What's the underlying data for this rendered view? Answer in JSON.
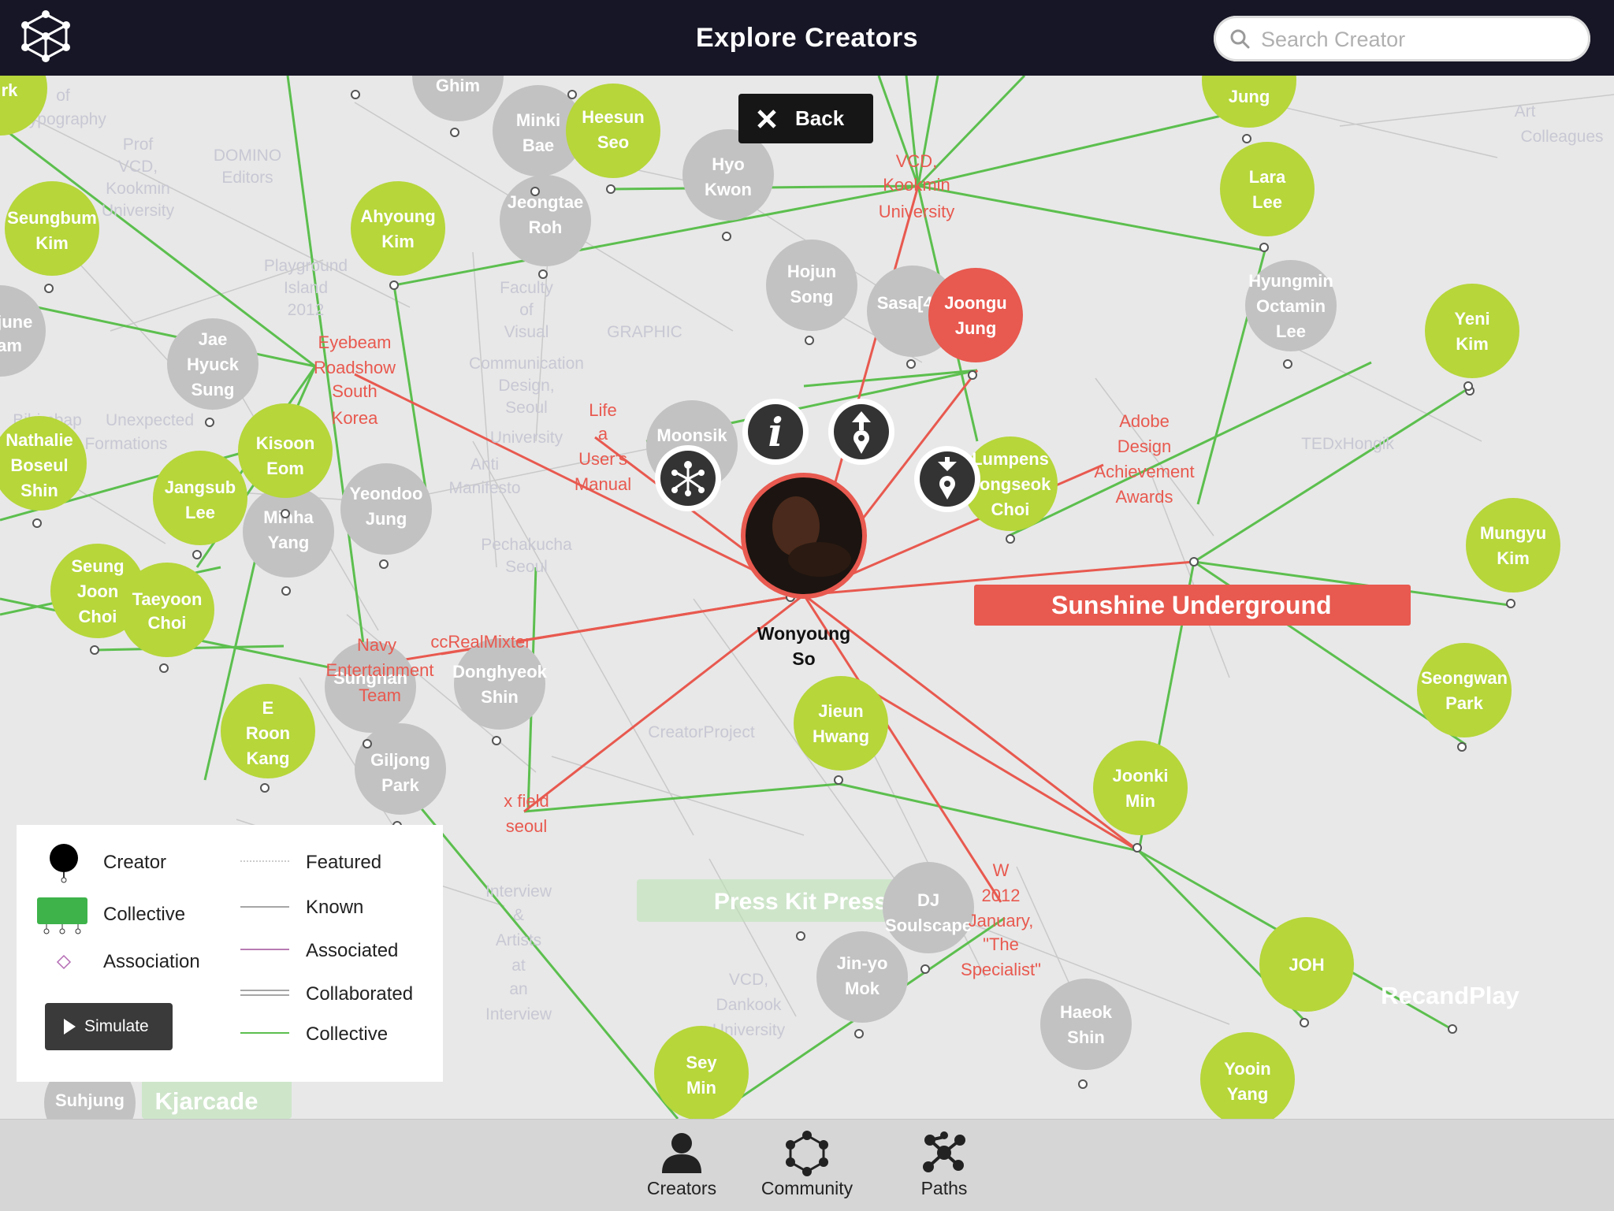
{
  "header": {
    "title": "Explore Creators",
    "search_placeholder": "Search Creator"
  },
  "back_button": {
    "label": "Back"
  },
  "selected_creator": {
    "name_line1": "Wonyoung",
    "name_line2": "So"
  },
  "highlight_banner": "Sunshine Underground",
  "colors": {
    "topbar": "#171626",
    "creator_green": "#b6d63a",
    "creator_grey": "#bdbdbd",
    "selected_red": "#e8594f",
    "collective_line": "#5cbf4e",
    "association_line": "#e8594f"
  },
  "creators_green": [
    {
      "lines": [
        "Heesun",
        "Seo"
      ]
    },
    {
      "lines": [
        "Ahyoung",
        "Kim"
      ]
    },
    {
      "lines": [
        "Seungbum",
        "Kim"
      ]
    },
    {
      "lines": [
        "Kisoon",
        "Eom"
      ]
    },
    {
      "lines": [
        "Jangsub",
        "Lee"
      ]
    },
    {
      "lines": [
        "Nathalie",
        "Boseul",
        "Shin"
      ]
    },
    {
      "lines": [
        "Seung",
        "Joon",
        "Choi"
      ]
    },
    {
      "lines": [
        "Taeyoon",
        "Choi"
      ]
    },
    {
      "lines": [
        "E",
        "Roon",
        "Kang"
      ]
    },
    {
      "lines": [
        "Jieun",
        "Hwang"
      ]
    },
    {
      "lines": [
        "Joonki",
        "Min"
      ]
    },
    {
      "lines": [
        "JOH"
      ]
    },
    {
      "lines": [
        "Yooin",
        "Yang"
      ]
    },
    {
      "lines": [
        "Sey",
        "Min"
      ]
    },
    {
      "lines": [
        "Lara",
        "Lee"
      ]
    },
    {
      "lines": [
        "Jung"
      ]
    },
    {
      "lines": [
        "Yeni",
        "Kim"
      ]
    },
    {
      "lines": [
        "Mungyu",
        "Kim"
      ]
    },
    {
      "lines": [
        "Seongwan",
        "Park"
      ]
    },
    {
      "lines": [
        "Lumpens",
        "Jongseok",
        "Choi"
      ]
    },
    {
      "lines": [
        "rk"
      ]
    }
  ],
  "creators_grey": [
    {
      "lines": [
        "Minki",
        "Bae"
      ]
    },
    {
      "lines": [
        "Ghim"
      ]
    },
    {
      "lines": [
        "Hyo",
        "Kwon"
      ]
    },
    {
      "lines": [
        "Jeongtae",
        "Roh"
      ]
    },
    {
      "lines": [
        "Hojun",
        "Song"
      ]
    },
    {
      "lines": [
        "Sasa[44]"
      ]
    },
    {
      "lines": [
        "Hyungmin",
        "Octamin",
        "Lee"
      ]
    },
    {
      "lines": [
        "Jae",
        "Hyuck",
        "Sung"
      ]
    },
    {
      "lines": [
        "Minha",
        "Yang"
      ]
    },
    {
      "lines": [
        "Yeondoo",
        "Jung"
      ]
    },
    {
      "lines": [
        "Moonsik"
      ]
    },
    {
      "lines": [
        "Sungnan"
      ]
    },
    {
      "lines": [
        "Donghyeok",
        "Shin"
      ]
    },
    {
      "lines": [
        "Giljong",
        "Park"
      ]
    },
    {
      "lines": [
        "DJ",
        "Soulscape"
      ]
    },
    {
      "lines": [
        "Jin-yo",
        "Mok"
      ]
    },
    {
      "lines": [
        "Haeok",
        "Shin"
      ]
    },
    {
      "lines": [
        "gjune",
        "am"
      ]
    },
    {
      "lines": [
        "Suhjung"
      ]
    }
  ],
  "creator_red": {
    "lines": [
      "Joongu",
      "Jung"
    ]
  },
  "red_labels": [
    {
      "lines": [
        "VCD,",
        "Kookmin",
        "University"
      ]
    },
    {
      "lines": [
        "Eyebeam",
        "Roadshow",
        "South",
        "Korea"
      ]
    },
    {
      "lines": [
        "Life",
        "a",
        "User's",
        "Manual"
      ]
    },
    {
      "lines": [
        "Adobe",
        "Design",
        "Achievement",
        "Awards"
      ]
    },
    {
      "lines": [
        "Navy",
        "Entertainment",
        "Team"
      ]
    },
    {
      "lines": [
        "ccRealMixter"
      ]
    },
    {
      "lines": [
        "x field",
        "seoul"
      ]
    },
    {
      "lines": [
        "W",
        "2012",
        "January,",
        "\"The",
        "Specialist\""
      ]
    }
  ],
  "faded_labels": [
    {
      "lines": [
        "Prof",
        "VCD,",
        "Kookmin",
        "University"
      ]
    },
    {
      "lines": [
        "DOMINO",
        "Editors"
      ]
    },
    {
      "lines": [
        "Playground",
        "Island",
        "2012"
      ]
    },
    {
      "lines": [
        "Faculty",
        "of",
        "Visual",
        "Communication",
        "Design,",
        "Seoul",
        "University",
        "Anti",
        "Manifesto"
      ]
    },
    {
      "lines": [
        "GRAPHIC"
      ]
    },
    {
      "lines": [
        "Pechakucha",
        "Seoul"
      ]
    },
    {
      "lines": [
        "Bibimbap",
        "Unexpected",
        "Formations"
      ]
    },
    {
      "lines": [
        "CreatorProject"
      ]
    },
    {
      "lines": [
        "Interview",
        "&",
        "Artists",
        "at",
        "an",
        "Interview"
      ]
    },
    {
      "lines": [
        "VCD,",
        "Dankook",
        "University"
      ]
    },
    {
      "lines": [
        "Art",
        "Colleagues"
      ]
    },
    {
      "lines": [
        "TEDxHongik"
      ]
    },
    {
      "lines": [
        "of",
        "Typography"
      ]
    }
  ],
  "collective_boxes": [
    {
      "label": "Press Kit Press"
    },
    {
      "label": "RecandPlay"
    },
    {
      "label": "Kjarcade"
    }
  ],
  "action_icons": [
    "info-icon",
    "upload-pin-icon",
    "download-pin-icon",
    "network-icon"
  ],
  "legend": {
    "node_types": [
      "Creator",
      "Collective",
      "Association"
    ],
    "link_types": [
      "Featured",
      "Known",
      "Associated",
      "Collaborated",
      "Collective"
    ],
    "simulate_label": "Simulate"
  },
  "tabs": [
    {
      "label": "Creators"
    },
    {
      "label": "Community"
    },
    {
      "label": "Paths"
    }
  ]
}
